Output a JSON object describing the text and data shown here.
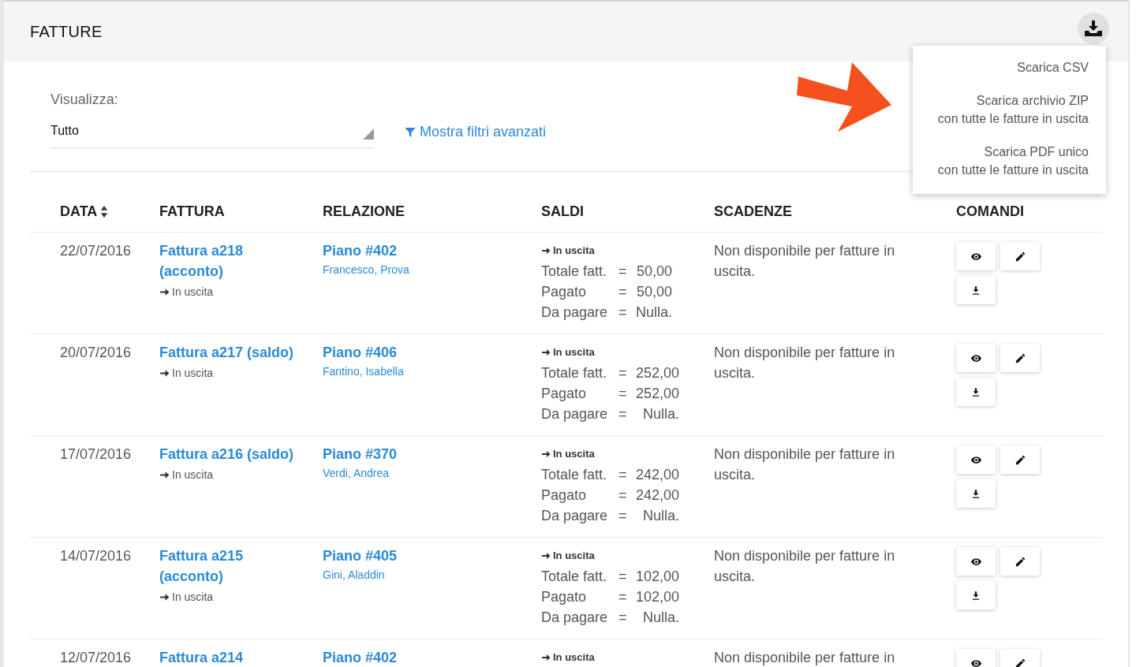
{
  "header": {
    "title": "FATTURE"
  },
  "download_menu": {
    "expanded": true,
    "items": [
      {
        "lines": [
          "Scarica CSV"
        ]
      },
      {
        "lines": [
          "Scarica archivio ZIP",
          "con tutte le fatture in uscita"
        ]
      },
      {
        "lines": [
          "Scarica PDF unico",
          "con tutte le fatture in uscita"
        ]
      }
    ]
  },
  "filters": {
    "label": "Visualizza:",
    "select_value": "Tutto",
    "advanced_link": "Mostra filtri avanzati"
  },
  "table": {
    "columns": [
      {
        "label": "DATA",
        "sortable": true
      },
      {
        "label": "FATTURA",
        "sortable": false
      },
      {
        "label": "RELAZIONE",
        "sortable": false
      },
      {
        "label": "SALDI",
        "sortable": false
      },
      {
        "label": "SCADENZE",
        "sortable": false
      },
      {
        "label": "COMANDI",
        "sortable": false
      }
    ],
    "rows": [
      {
        "date": "22/07/2016",
        "invoice": "Fattura a218 (acconto)",
        "direction": "In uscita",
        "relation": "Piano #402",
        "client": "Francesco, Prova",
        "saldi": {
          "direction": "In uscita",
          "lines": [
            {
              "label": "Totale fatt.",
              "eq": "=",
              "value": "50,00"
            },
            {
              "label": "Pagato",
              "eq": "=",
              "value": "50,00"
            },
            {
              "label": "Da pagare",
              "eq": "=",
              "value": "Nulla."
            }
          ]
        },
        "deadline": "Non disponibile per fatture in uscita.",
        "commands": [
          {
            "kind": "view"
          },
          {
            "kind": "edit"
          },
          {
            "kind": "download"
          }
        ]
      },
      {
        "date": "20/07/2016",
        "invoice": "Fattura a217 (saldo)",
        "direction": "In uscita",
        "relation": "Piano #406",
        "client": "Fantino, Isabella",
        "saldi": {
          "direction": "In uscita",
          "lines": [
            {
              "label": "Totale fatt.",
              "eq": "=",
              "value": "252,00"
            },
            {
              "label": "Pagato",
              "eq": "=",
              "value": "252,00"
            },
            {
              "label": "Da pagare",
              "eq": "=",
              "value": "Nulla."
            }
          ]
        },
        "deadline": "Non disponibile per fatture in uscita.",
        "commands": [
          {
            "kind": "view"
          },
          {
            "kind": "edit"
          },
          {
            "kind": "download"
          }
        ]
      },
      {
        "date": "17/07/2016",
        "invoice": "Fattura a216 (saldo)",
        "direction": "In uscita",
        "relation": "Piano #370",
        "client": "Verdi, Andrea",
        "saldi": {
          "direction": "In uscita",
          "lines": [
            {
              "label": "Totale fatt.",
              "eq": "=",
              "value": "242,00"
            },
            {
              "label": "Pagato",
              "eq": "=",
              "value": "242,00"
            },
            {
              "label": "Da pagare",
              "eq": "=",
              "value": "Nulla."
            }
          ]
        },
        "deadline": "Non disponibile per fatture in uscita.",
        "commands": [
          {
            "kind": "view"
          },
          {
            "kind": "edit"
          },
          {
            "kind": "download"
          }
        ]
      },
      {
        "date": "14/07/2016",
        "invoice": "Fattura a215 (acconto)",
        "direction": "In uscita",
        "relation": "Piano #405",
        "client": "Gini, Aladdin",
        "saldi": {
          "direction": "In uscita",
          "lines": [
            {
              "label": "Totale fatt.",
              "eq": "=",
              "value": "102,00"
            },
            {
              "label": "Pagato",
              "eq": "=",
              "value": "102,00"
            },
            {
              "label": "Da pagare",
              "eq": "=",
              "value": "Nulla."
            }
          ]
        },
        "deadline": "Non disponibile per fatture in uscita.",
        "commands": [
          {
            "kind": "view"
          },
          {
            "kind": "edit"
          },
          {
            "kind": "download"
          }
        ]
      },
      {
        "date": "12/07/2016",
        "invoice": "Fattura a214",
        "relation": "Piano #402",
        "saldi": {
          "direction": "In uscita"
        },
        "deadline": "Non disponibile per fatture in",
        "commands": [
          {
            "kind": "view"
          },
          {
            "kind": "edit"
          }
        ]
      }
    ]
  }
}
